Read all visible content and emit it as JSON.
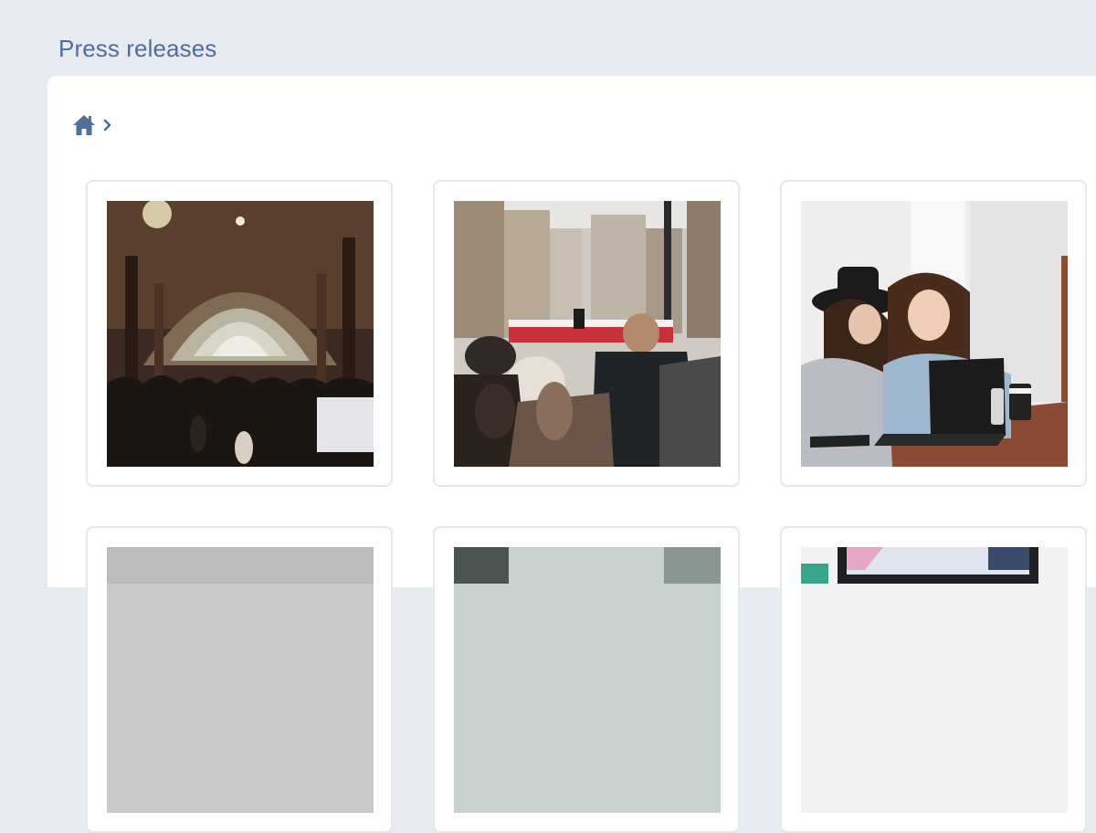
{
  "page": {
    "title": "Press releases"
  },
  "breadcrumb": {
    "icons": [
      "home-icon",
      "chevron-right-icon"
    ]
  },
  "cards": [
    {
      "image": "photo-market-hall-crowd"
    },
    {
      "image": "photo-street-parade-crowd"
    },
    {
      "image": "photo-two-women-laptop"
    },
    {
      "image": "photo-grey-wall"
    },
    {
      "image": "photo-desk-scene"
    },
    {
      "image": "photo-monitor-design"
    }
  ],
  "colors": {
    "background": "#e6eaf1",
    "accent": "#4f6f9c",
    "panel": "#ffffff",
    "card_border": "#e4e7ec"
  }
}
